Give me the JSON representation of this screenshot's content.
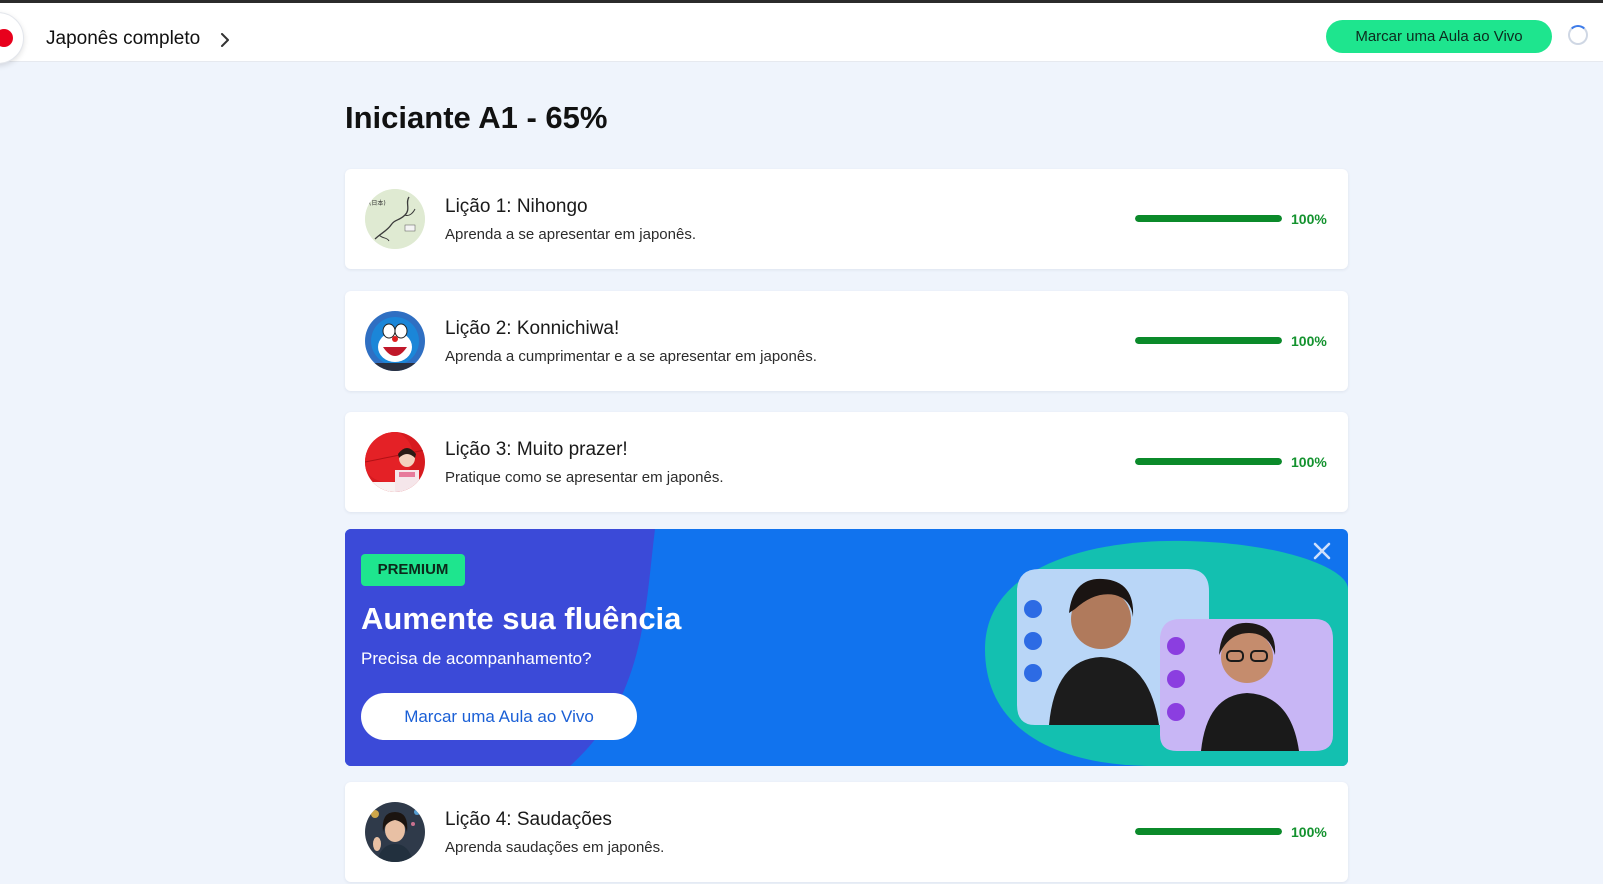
{
  "header": {
    "course_title": "Japonês completo",
    "cta_label": "Marcar uma Aula ao Vivo"
  },
  "level": {
    "name": "Iniciante A1 - ",
    "progress_label": "65%"
  },
  "lessons": [
    {
      "title": "Lição 1: Nihongo",
      "description": "Aprenda a se apresentar em japonês.",
      "progress": 1.0,
      "progress_label": "100%",
      "thumb_icon": "japan-map-thumbnail"
    },
    {
      "title": "Lição 2: Konnichiwa!",
      "description": "Aprenda a cumprimentar e a se apresentar em japonês.",
      "progress": 1.0,
      "progress_label": "100%",
      "thumb_icon": "doraemon-thumbnail"
    },
    {
      "title": "Lição 3: Muito prazer!",
      "description": "Pratique como se apresentar em japonês.",
      "progress": 1.0,
      "progress_label": "100%",
      "thumb_icon": "kimono-umbrella-thumbnail"
    },
    {
      "title": "Lição 4: Saudações",
      "description": "Aprenda saudações em japonês.",
      "progress": 1.0,
      "progress_label": "100%",
      "thumb_icon": "waving-woman-thumbnail"
    }
  ],
  "premium_banner": {
    "badge": "PREMIUM",
    "title": "Aumente sua fluência",
    "subtitle": "Precisa de acompanhamento?",
    "cta_label": "Marcar uma Aula ao Vivo"
  },
  "colors": {
    "accent_green": "#1ee58e",
    "progress_green": "#0b8a2a",
    "banner_blue": "#1173ee",
    "banner_indigo": "#3b4ad8",
    "banner_teal": "#13c0b0"
  }
}
